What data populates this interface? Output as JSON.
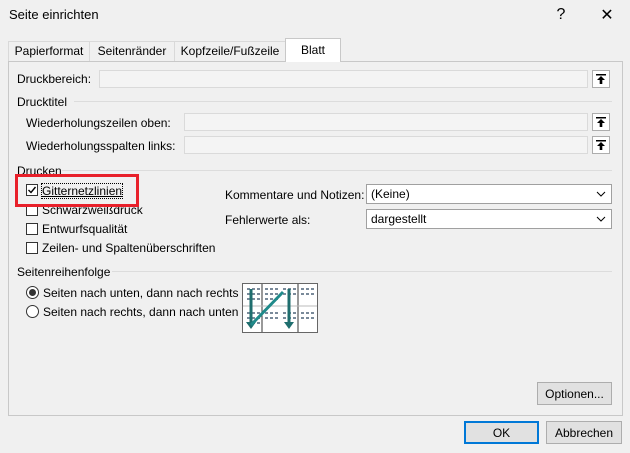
{
  "window": {
    "title": "Seite einrichten",
    "help_icon": "?",
    "close_icon": "✕"
  },
  "tabs": [
    {
      "label": "Papierformat"
    },
    {
      "label": "Seitenränder"
    },
    {
      "label": "Kopfzeile/Fußzeile"
    },
    {
      "label": "Blatt"
    }
  ],
  "druckbereich": {
    "label": "Druckbereich:"
  },
  "drucktitel": {
    "group_label": "Drucktitel",
    "rows_label": "Wiederholungszeilen oben:",
    "cols_label": "Wiederholungsspalten links:"
  },
  "drucken": {
    "group_label": "Drucken",
    "options": [
      {
        "label": "Gitternetzlinien",
        "checked": true
      },
      {
        "label": "Schwarzweißdruck",
        "checked": false
      },
      {
        "label": "Entwurfsqualität",
        "checked": false
      },
      {
        "label": "Zeilen- und Spaltenüberschriften",
        "checked": false
      }
    ],
    "comments_label": "Kommentare und Notizen:",
    "comments_value": "(Keine)",
    "errors_label": "Fehlerwerte als:",
    "errors_value": "dargestellt"
  },
  "order": {
    "group_label": "Seitenreihenfolge",
    "options": [
      {
        "label": "Seiten nach unten, dann nach rechts",
        "selected": true
      },
      {
        "label": "Seiten nach rechts, dann nach unten",
        "selected": false
      }
    ]
  },
  "buttons": {
    "options": "Optionen...",
    "ok": "OK",
    "cancel": "Abbrechen"
  },
  "colors": {
    "accent": "#0078d7",
    "highlight": "#e8202a",
    "arrow": "#1f8a8a"
  }
}
